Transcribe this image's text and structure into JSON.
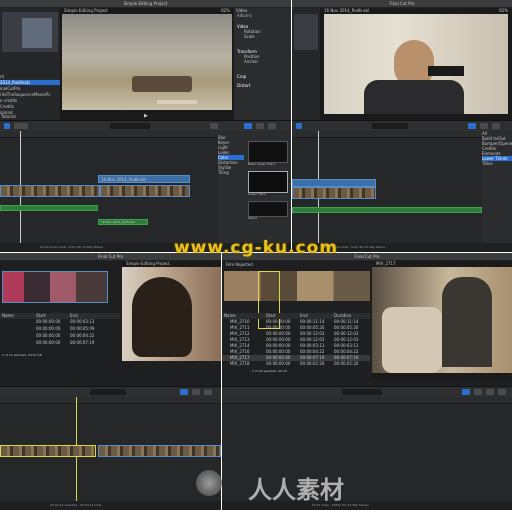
{
  "q1": {
    "window_title": "Simple Editing Project",
    "zoom": "62%",
    "viewer_title": "Simple Editing Project",
    "event_title": "Tutorial",
    "browser_items": [
      "nt",
      "2014_Pudlinski",
      "inalCutPro",
      "riteTheSequenceMoviePc",
      "e credits",
      "Credits",
      "iginals"
    ],
    "inspector_title": "Video",
    "inspector_sections": [
      "Video",
      "Albums",
      "Transform",
      "Crop",
      "Distort"
    ],
    "inspector_fields": [
      "Rotation",
      "Scale",
      "Position",
      "Anchor"
    ],
    "clip_label": "16 Nov 2014_Pudlinski",
    "audio_label": "16 Nov 2014_Pudlinski",
    "effects_categories": [
      "Blur",
      "Keyer",
      "Light",
      "Looks",
      "Color",
      "Distortion",
      "Stylize",
      "Tiling"
    ],
    "effects_items": [
      "Basic Lower Third",
      "Lower Third",
      "Stand",
      "Pulse",
      "Boxes"
    ],
    "status": "00:00:14:12 total, 720p HD 23.98p Stereo"
  },
  "q2": {
    "window_title": "Final Cut Pro",
    "zoom": "62%",
    "viewer_title": "16 Nov 2014_Pudlinski",
    "effects_categories": [
      "All",
      "Build In/Out",
      "Bumper/Opener",
      "Credits",
      "Elements",
      "Lower Thirds",
      "Titles"
    ],
    "status": "00:00:17:01 total, 720p HD 23.98p Stereo"
  },
  "q3": {
    "window_title": "Final Cut Pro",
    "viewer_title": "Simple Editing Project",
    "columns": [
      "Name",
      "Start",
      "End"
    ],
    "rows": [
      [
        "MVI_2714",
        "00:00:00:00",
        "00:00:03:13"
      ],
      [
        "MVI_2715",
        "00:00:00:00",
        "00:00:05:09"
      ],
      [
        "MVI_2716",
        "00:00:00:00",
        "00:00:04:22"
      ],
      [
        "MVI_2717",
        "00:00:00:00",
        "00:00:07:19"
      ]
    ],
    "status": "1 of 11 selected, 00:07:18",
    "footer": "00:02:42 selected - 00:04:14 total"
  },
  "q4": {
    "window_title": "Final Cut Pro",
    "event_title": "Film Rejected",
    "viewer_title": "MVI_2717",
    "columns": [
      "Name",
      "Start",
      "End",
      "Duration"
    ],
    "rows": [
      [
        "MVI_2710",
        "00:00:00:00",
        "00:00:11:14",
        "00:00:11:14"
      ],
      [
        "MVI_2711",
        "00:00:00:00",
        "00:00:05:20",
        "00:00:05:20"
      ],
      [
        "MVI_2712",
        "00:00:00:00",
        "00:00:12:03",
        "00:00:12:03"
      ],
      [
        "MVI_2713",
        "00:00:00:00",
        "00:00:12:03",
        "00:00:12:03"
      ],
      [
        "MVI_2714",
        "00:00:00:00",
        "00:00:03:13",
        "00:00:03:13"
      ],
      [
        "MVI_2716",
        "00:00:00:00",
        "00:00:04:22",
        "00:00:04:22"
      ],
      [
        "MVI_2717",
        "00:00:00:00",
        "00:00:07:19",
        "00:00:07:19"
      ],
      [
        "MVI_2718",
        "00:00:00:00",
        "00:00:02:20",
        "00:00:02:20"
      ]
    ],
    "status": "1 of 20 selected, 00:18",
    "footer": "00:21 total - 1080p HD 23.98p Stereo"
  },
  "watermark_top": "www.cg-ku.com",
  "watermark_bottom": "人人素材"
}
